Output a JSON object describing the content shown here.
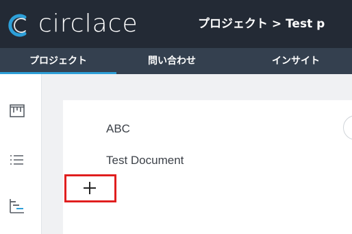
{
  "header": {
    "logo_text": "circlace",
    "breadcrumb": "プロジェクト > Test p"
  },
  "tabs": [
    {
      "label": "プロジェクト",
      "active": true
    },
    {
      "label": "問い合わせ",
      "active": false
    },
    {
      "label": "インサイト",
      "active": false
    }
  ],
  "rail": {
    "icons": [
      "kanban-board-icon",
      "list-icon",
      "gantt-chart-icon"
    ]
  },
  "documents": [
    {
      "label": "ABC"
    },
    {
      "label": "Test Document"
    }
  ],
  "add_button": {
    "icon": "plus-icon",
    "highlight_color": "#e01e1e"
  },
  "colors": {
    "header_bg": "#232a35",
    "tabbar_bg": "#34404f",
    "tab_active_underline": "#2d9fd8",
    "page_bg": "#f0f1f3"
  }
}
